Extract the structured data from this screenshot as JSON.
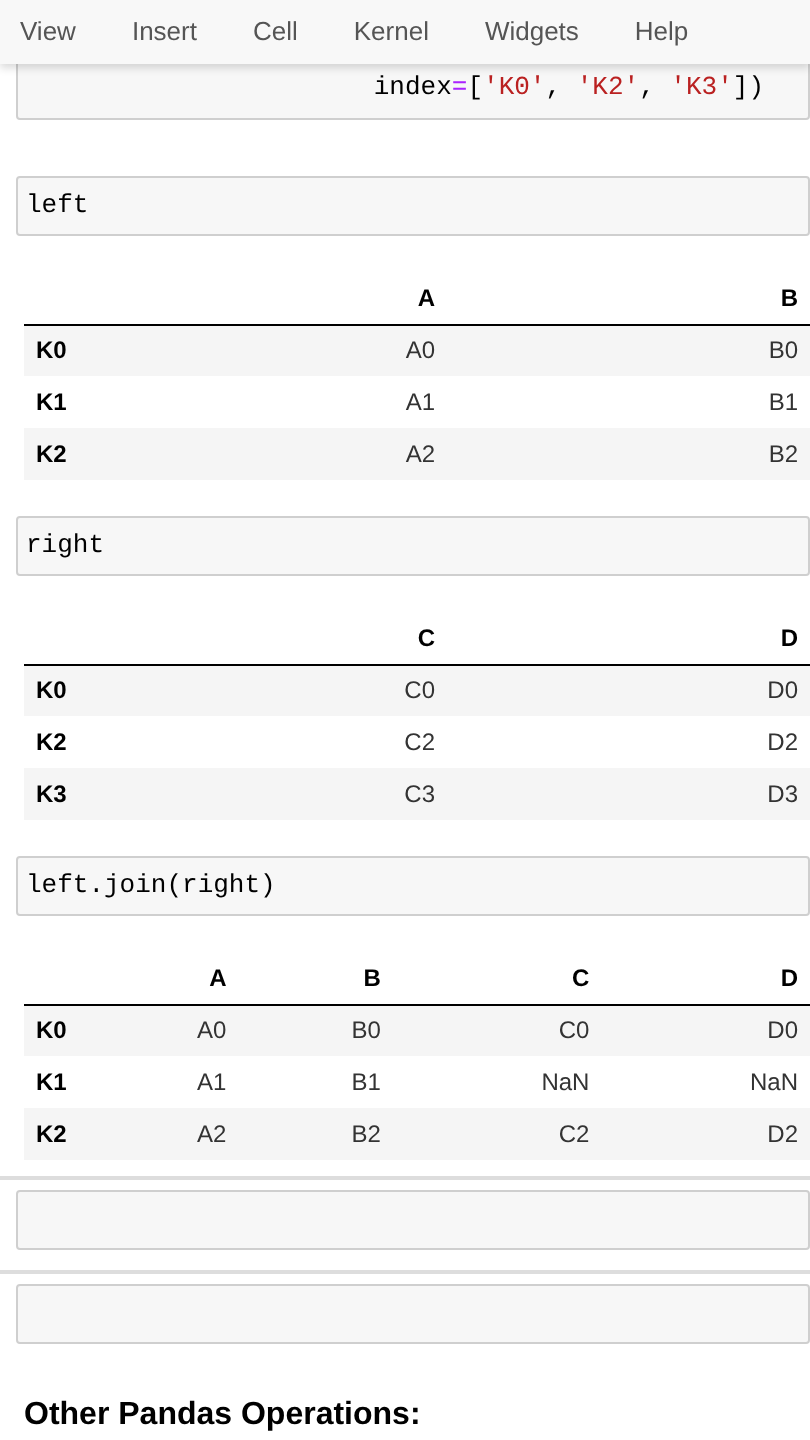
{
  "menu": [
    "View",
    "Insert",
    "Cell",
    "Kernel",
    "Widgets",
    "Help"
  ],
  "cells": [
    {
      "kind": "code",
      "tokens": [
        {
          "text": "index",
          "kind": "plain"
        },
        {
          "text": "=",
          "kind": "operator"
        },
        {
          "text": "[",
          "kind": "plain"
        },
        {
          "text": "'K0'",
          "kind": "string"
        },
        {
          "text": ", ",
          "kind": "plain"
        },
        {
          "text": "'K2'",
          "kind": "string"
        },
        {
          "text": ", ",
          "kind": "plain"
        },
        {
          "text": "'K3'",
          "kind": "string"
        },
        {
          "text": "])",
          "kind": "plain"
        }
      ]
    },
    {
      "kind": "code",
      "tokens": [
        {
          "text": "left",
          "kind": "plain"
        }
      ]
    },
    {
      "kind": "table",
      "columns": [
        "A",
        "B"
      ],
      "rows": [
        {
          "index": "K0",
          "cells": [
            "A0",
            "B0"
          ]
        },
        {
          "index": "K1",
          "cells": [
            "A1",
            "B1"
          ]
        },
        {
          "index": "K2",
          "cells": [
            "A2",
            "B2"
          ]
        }
      ]
    },
    {
      "kind": "code",
      "tokens": [
        {
          "text": "right",
          "kind": "plain"
        }
      ]
    },
    {
      "kind": "table",
      "columns": [
        "C",
        "D"
      ],
      "rows": [
        {
          "index": "K0",
          "cells": [
            "C0",
            "D0"
          ]
        },
        {
          "index": "K2",
          "cells": [
            "C2",
            "D2"
          ]
        },
        {
          "index": "K3",
          "cells": [
            "C3",
            "D3"
          ]
        }
      ]
    },
    {
      "kind": "code",
      "tokens": [
        {
          "text": "left.join(right)",
          "kind": "plain"
        }
      ]
    },
    {
      "kind": "table",
      "columns": [
        "A",
        "B",
        "C",
        "D"
      ],
      "rows": [
        {
          "index": "K0",
          "cells": [
            "A0",
            "B0",
            "C0",
            "D0"
          ]
        },
        {
          "index": "K1",
          "cells": [
            "A1",
            "B1",
            "NaN",
            "NaN"
          ]
        },
        {
          "index": "K2",
          "cells": [
            "A2",
            "B2",
            "C2",
            "D2"
          ]
        }
      ]
    },
    {
      "kind": "empty"
    },
    {
      "kind": "empty"
    },
    {
      "kind": "heading",
      "text": "Other Pandas Operations:"
    }
  ]
}
